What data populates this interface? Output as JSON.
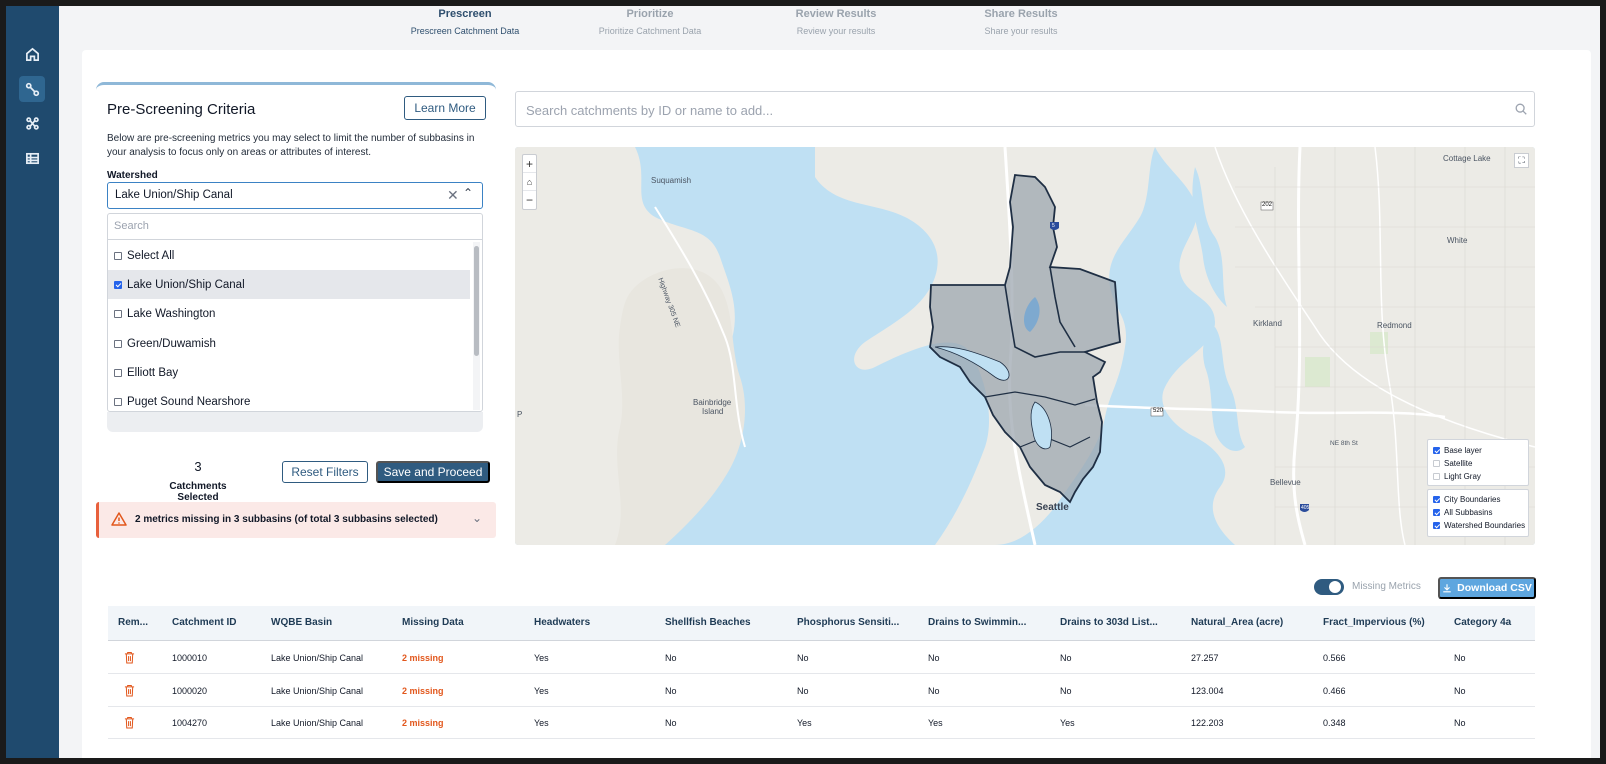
{
  "stepper": [
    {
      "title": "Prescreen",
      "subtitle": "Prescreen Catchment Data"
    },
    {
      "title": "Prioritize",
      "subtitle": "Prioritize Catchment Data"
    },
    {
      "title": "Review Results",
      "subtitle": "Review your results"
    },
    {
      "title": "Share Results",
      "subtitle": "Share your results"
    }
  ],
  "criteria": {
    "title": "Pre-Screening Criteria",
    "learn_more": "Learn More",
    "description": "Below are pre-screening metrics you may select to limit the number of subbasins in your analysis to focus only on areas or attributes of interest.",
    "watershed_label": "Watershed",
    "watershed_value": "Lake Union/Ship Canal",
    "dropdown_search_placeholder": "Search",
    "options": [
      {
        "label": "Select All",
        "checked": false
      },
      {
        "label": "Lake Union/Ship Canal",
        "checked": true
      },
      {
        "label": "Lake Washington",
        "checked": false
      },
      {
        "label": "Green/Duwamish",
        "checked": false
      },
      {
        "label": "Elliott Bay",
        "checked": false
      },
      {
        "label": "Puget Sound Nearshore",
        "checked": false
      }
    ],
    "count": "3",
    "count_label": "Catchments Selected",
    "reset": "Reset Filters",
    "save": "Save and Proceed"
  },
  "alert": {
    "text": "2 metrics missing in 3 subbasins (of total 3 subbasins selected)"
  },
  "search": {
    "placeholder": "Search catchments by ID or name to add..."
  },
  "map": {
    "labels": {
      "suquamish": "Suquamish",
      "bainbridge1": "Bainbridge",
      "bainbridge2": "Island",
      "seattle": "Seattle",
      "kirkland": "Kirkland",
      "redmond": "Redmond",
      "bellevue": "Bellevue",
      "white": "White",
      "cottage": "Cottage Lake",
      "p": "P",
      "hwy": "Highway 305 NE",
      "ne8": "NE 8th St",
      "r520": "520",
      "r202": "202",
      "r5": "5",
      "r405": "405"
    },
    "layers": [
      {
        "label": "Base layer",
        "checked": true
      },
      {
        "label": "Satellite",
        "checked": false
      },
      {
        "label": "Light Gray",
        "checked": false
      },
      {
        "label": "City Boundaries",
        "checked": true
      },
      {
        "label": "All Subbasins",
        "checked": true
      },
      {
        "label": "Watershed Boundaries",
        "checked": true
      }
    ]
  },
  "table": {
    "missing_toggle_label": "Missing Metrics",
    "download": "Download CSV",
    "columns": [
      "Rem...",
      "Catchment ID",
      "WQBE Basin",
      "Missing Data",
      "Headwaters",
      "Shellfish Beaches",
      "Phosphorus Sensiti...",
      "Drains to Swimmin...",
      "Drains to 303d List...",
      "Natural_Area (acre)",
      "Fract_Impervious (%)",
      "Category 4a"
    ],
    "rows": [
      [
        "1000010",
        "Lake Union/Ship Canal",
        "2 missing",
        "Yes",
        "No",
        "No",
        "No",
        "No",
        "27.257",
        "0.566",
        "No"
      ],
      [
        "1000020",
        "Lake Union/Ship Canal",
        "2 missing",
        "Yes",
        "No",
        "No",
        "No",
        "No",
        "123.004",
        "0.466",
        "No"
      ],
      [
        "1004270",
        "Lake Union/Ship Canal",
        "2 missing",
        "Yes",
        "No",
        "Yes",
        "Yes",
        "Yes",
        "122.203",
        "0.348",
        "No"
      ]
    ]
  },
  "colors": {
    "sidebar": "#1f4a6e",
    "primary": "#2f5b80",
    "accent": "#5ea6df",
    "warning": "#e2571c",
    "water": "#bfe0f3"
  }
}
